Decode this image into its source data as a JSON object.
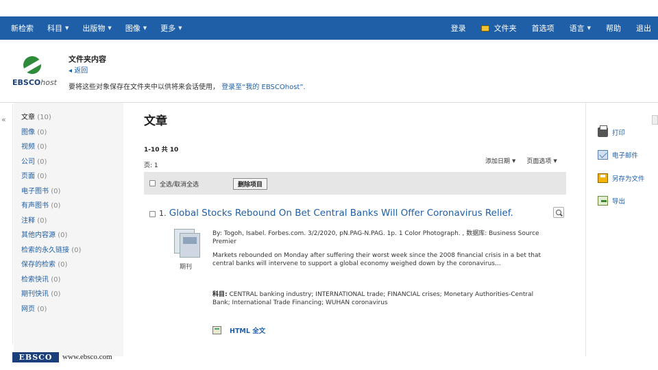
{
  "topnav": {
    "left": [
      {
        "label": "新检索",
        "dropdown": false
      },
      {
        "label": "科目",
        "dropdown": true
      },
      {
        "label": "出版物",
        "dropdown": true
      },
      {
        "label": "图像",
        "dropdown": true
      },
      {
        "label": "更多",
        "dropdown": true
      }
    ],
    "right": {
      "signin": "登录",
      "folder": "文件夹",
      "preferences": "首选项",
      "language": "语言",
      "help": "帮助",
      "exit": "退出"
    },
    "caret": "▼"
  },
  "header": {
    "logo_main": "EBSCO",
    "logo_host": "host",
    "title": "文件夹内容",
    "back": "◂ 返回",
    "message": "要将这些对象保存在文件夹中以供将来会话使用，",
    "signin_link": "登录至“我的 EBSCOhost”."
  },
  "sidebar": {
    "collapse": "«",
    "items": [
      {
        "label": "文章",
        "count": "(10)",
        "active": true
      },
      {
        "label": "图像",
        "count": "(0)"
      },
      {
        "label": "视频",
        "count": "(0)"
      },
      {
        "label": "公司",
        "count": "(0)"
      },
      {
        "label": "页面",
        "count": "(0)"
      },
      {
        "label": "电子图书",
        "count": "(0)"
      },
      {
        "label": "有声图书",
        "count": "(0)"
      },
      {
        "label": "注释",
        "count": "(0)"
      },
      {
        "label": "其他内容源",
        "count": "(0)"
      },
      {
        "label": "检索的永久链接",
        "count": "(0)"
      },
      {
        "label": "保存的检索",
        "count": "(0)"
      },
      {
        "label": "检索快讯",
        "count": "(0)"
      },
      {
        "label": "期刊快讯",
        "count": "(0)"
      },
      {
        "label": "网页",
        "count": "(0)"
      }
    ]
  },
  "main": {
    "title": "文章",
    "range": "1-10 共 10",
    "page": "页: 1",
    "sort_added": "添加日期",
    "page_options": "页面选项",
    "select_all": "全选/取消全选",
    "delete_button": "删除项目",
    "result": {
      "number": "1.",
      "title": "Global Stocks Rebound On Bet Central Banks Will Offer Coronavirus Relief.",
      "meta": "By: Togoh, Isabel. Forbes.com. 3/2/2020, pN.PAG-N.PAG. 1p. 1 Color Photograph. , 数据库: Business Source Premier",
      "snippet": "Markets rebounded on Monday after suffering their worst week since the 2008 financial crisis in a bet that central banks will intervene to support a global economy weighed down by the coronavirus...",
      "subjects_label": "科目:",
      "subjects": "CENTRAL banking industry; INTERNATIONAL trade; FINANCIAL crises; Monetary Authorities-Central Bank; International Trade Financing; WUHAN coronavirus",
      "thumb_label": "期刊",
      "fulltext": "HTML 全文"
    }
  },
  "actions": [
    {
      "label": "打印",
      "icon": "printer-icon"
    },
    {
      "label": "电子邮件",
      "icon": "email-icon"
    },
    {
      "label": "另存为文件",
      "icon": "save-icon"
    },
    {
      "label": "导出",
      "icon": "export-icon"
    }
  ],
  "footer": {
    "logo": "EBSCO",
    "url": "www.ebsco.com"
  }
}
